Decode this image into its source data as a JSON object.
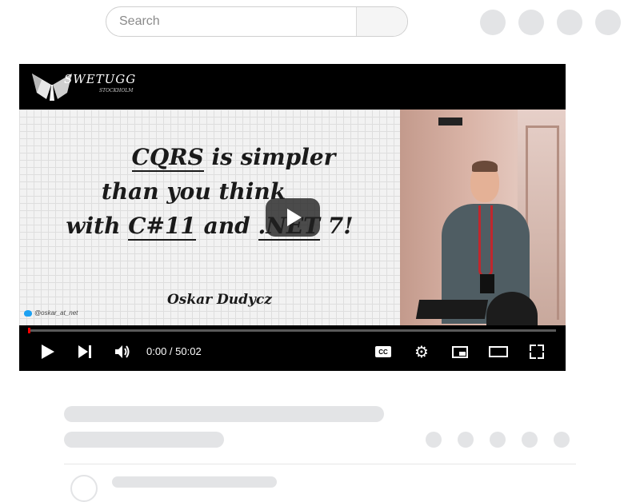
{
  "search": {
    "placeholder": "Search"
  },
  "video": {
    "channel_logo_text": "SWETUGG",
    "channel_logo_sub": "STOCKHOLM",
    "slide": {
      "line1_underlined": "CQRS",
      "line1_rest": " is simpler",
      "line2": "than you think",
      "line3_prefix": "with ",
      "line3_csharp": "C#11",
      "line3_mid": " and ",
      "line3_dotnet": ".NET",
      "line3_suffix": " 7!",
      "presenter": "Oskar Dudycz",
      "twitter_handle": "@oskar_at_net"
    },
    "progress_fraction": 0.0,
    "time": {
      "current": "0:00",
      "separator": " / ",
      "duration": "50:02"
    },
    "cc_label": "CC"
  },
  "colors": {
    "progress": "#ff0000",
    "skeleton": "#e3e4e6",
    "player_bg": "#000000"
  },
  "icons": [
    "search-icon",
    "play-icon",
    "next-icon",
    "volume-icon",
    "captions-icon",
    "gear-icon",
    "miniplayer-icon",
    "theater-icon",
    "fullscreen-icon",
    "logo-icon"
  ]
}
